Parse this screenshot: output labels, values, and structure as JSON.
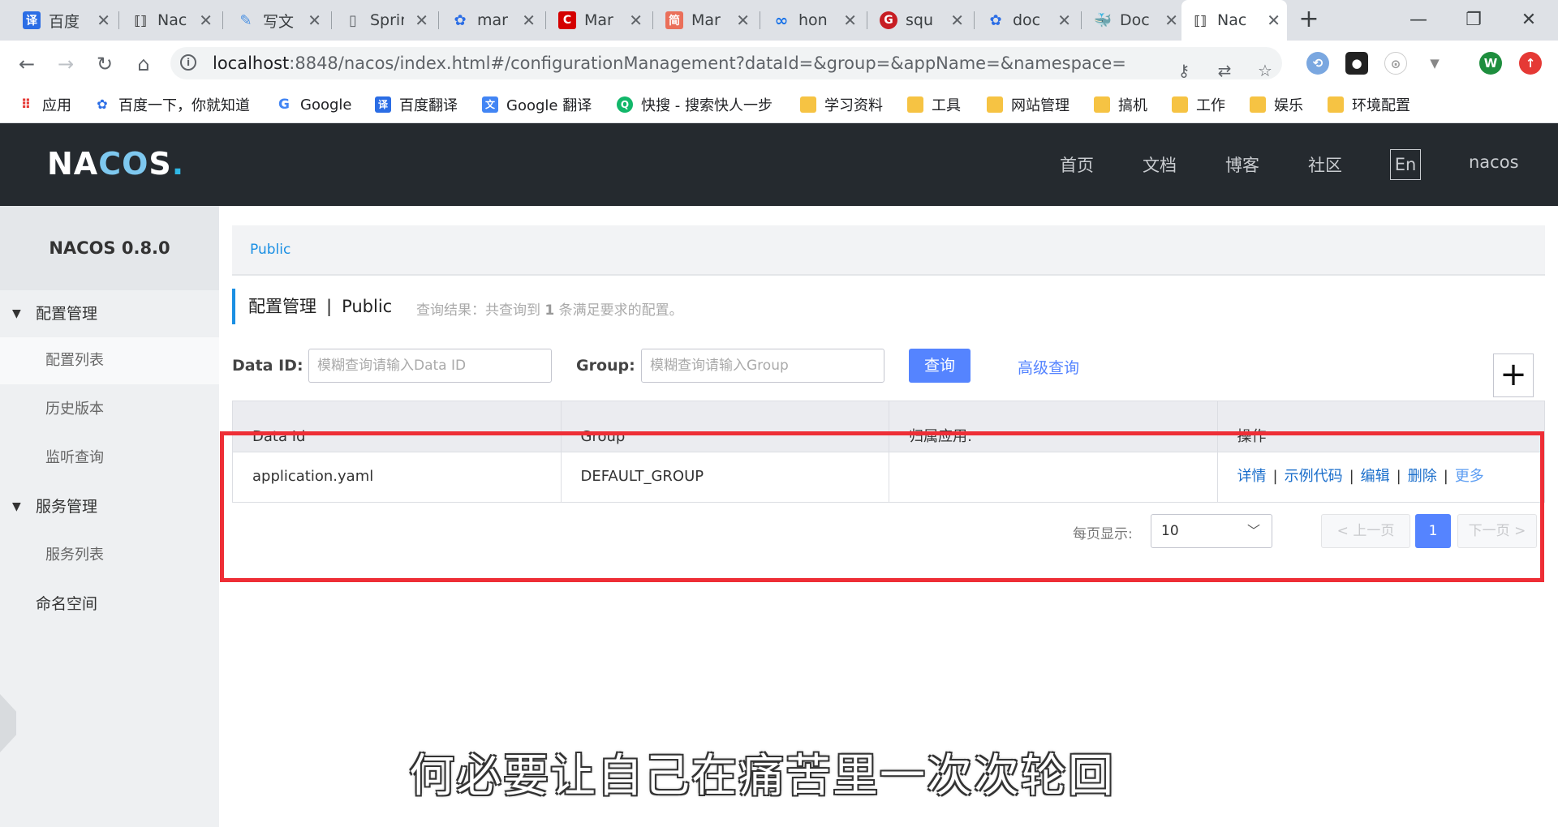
{
  "browser": {
    "tabs": [
      {
        "label": "百度",
        "favicon": "fanyi-icon",
        "color": "#2b6de5"
      },
      {
        "label": "Nac",
        "favicon": "nacos-icon",
        "color": "#333333"
      },
      {
        "label": "写文",
        "favicon": "csdn-write-icon",
        "color": "#4a90e2"
      },
      {
        "label": "Sprin",
        "favicon": "page-icon",
        "color": "#9aa0a6"
      },
      {
        "label": "mar",
        "favicon": "baidu-paw-icon",
        "color": "#2b6de5"
      },
      {
        "label": "Mar",
        "favicon": "csdn-c-icon",
        "color": "#d40000"
      },
      {
        "label": "Mar",
        "favicon": "jianshu-icon",
        "color": "#ea6f5a"
      },
      {
        "label": "hon",
        "favicon": "infinity-icon",
        "color": "#1a73e8"
      },
      {
        "label": "squ",
        "favicon": "gitee-icon",
        "color": "#c71d23"
      },
      {
        "label": "doc",
        "favicon": "baidu-paw-icon",
        "color": "#2b6de5"
      },
      {
        "label": "Doc",
        "favicon": "docker-icon",
        "color": "#2496ed"
      },
      {
        "label": "Nac",
        "favicon": "nacos-icon",
        "color": "#333333"
      }
    ],
    "url_host": "localhost",
    "url_rest": ":8848/nacos/index.html#/configurationManagement?dataId=&group=&appName=&namespace=",
    "profile_initial": "W",
    "bookmarks": [
      {
        "label": "应用",
        "icon": "apps-grid-icon"
      },
      {
        "label": "百度一下，你就知道",
        "icon": "baidu-paw-icon"
      },
      {
        "label": "Google",
        "icon": "google-icon"
      },
      {
        "label": "百度翻译",
        "icon": "fanyi-icon"
      },
      {
        "label": "Google 翻译",
        "icon": "google-translate-icon"
      },
      {
        "label": "快搜 - 搜索快人一步",
        "icon": "kuaisou-icon"
      },
      {
        "label": "学习资料",
        "icon": "folder-icon"
      },
      {
        "label": "工具",
        "icon": "folder-icon"
      },
      {
        "label": "网站管理",
        "icon": "folder-icon"
      },
      {
        "label": "搞机",
        "icon": "folder-icon"
      },
      {
        "label": "工作",
        "icon": "folder-icon"
      },
      {
        "label": "娱乐",
        "icon": "folder-icon"
      },
      {
        "label": "环境配置",
        "icon": "folder-icon"
      }
    ]
  },
  "header": {
    "logo": "NACOS",
    "nav": [
      "首页",
      "文档",
      "博客",
      "社区"
    ],
    "lang": "En",
    "user": "nacos"
  },
  "sidebar": {
    "title": "NACOS 0.8.0",
    "groups": [
      {
        "label": "配置管理",
        "items": [
          "配置列表",
          "历史版本",
          "监听查询"
        ]
      },
      {
        "label": "服务管理",
        "items": [
          "服务列表"
        ]
      }
    ],
    "namespace_item": "命名空间"
  },
  "main": {
    "namespace_tab": "Public",
    "page_title": "配置管理",
    "page_sep": "|",
    "page_ns": "Public",
    "query_result_prefix": "查询结果：共查询到",
    "query_result_count": "1",
    "query_result_suffix": "条满足要求的配置。",
    "filters": {
      "data_id_label": "Data ID:",
      "data_id_placeholder": "模糊查询请输入Data ID",
      "group_label": "Group:",
      "group_placeholder": "模糊查询请输入Group",
      "query_button": "查询",
      "advanced_link": "高级查询",
      "add_button": "+"
    },
    "table": {
      "columns": [
        "Data Id",
        "Group",
        "归属应用:",
        "操作"
      ],
      "rows": [
        {
          "data_id": "application.yaml",
          "group": "DEFAULT_GROUP",
          "app": "",
          "actions": [
            "详情",
            "示例代码",
            "编辑",
            "删除",
            "更多"
          ]
        }
      ]
    },
    "pagination": {
      "per_page_label": "每页显示:",
      "per_page_value": "10",
      "prev": "上一页",
      "current": "1",
      "next": "下一页"
    }
  },
  "subtitle": "何必要让自己在痛苦里一次次轮回",
  "colors": {
    "accent": "#5584ff",
    "header_bg": "#252a2f",
    "highlight_border": "#ee2e36"
  }
}
